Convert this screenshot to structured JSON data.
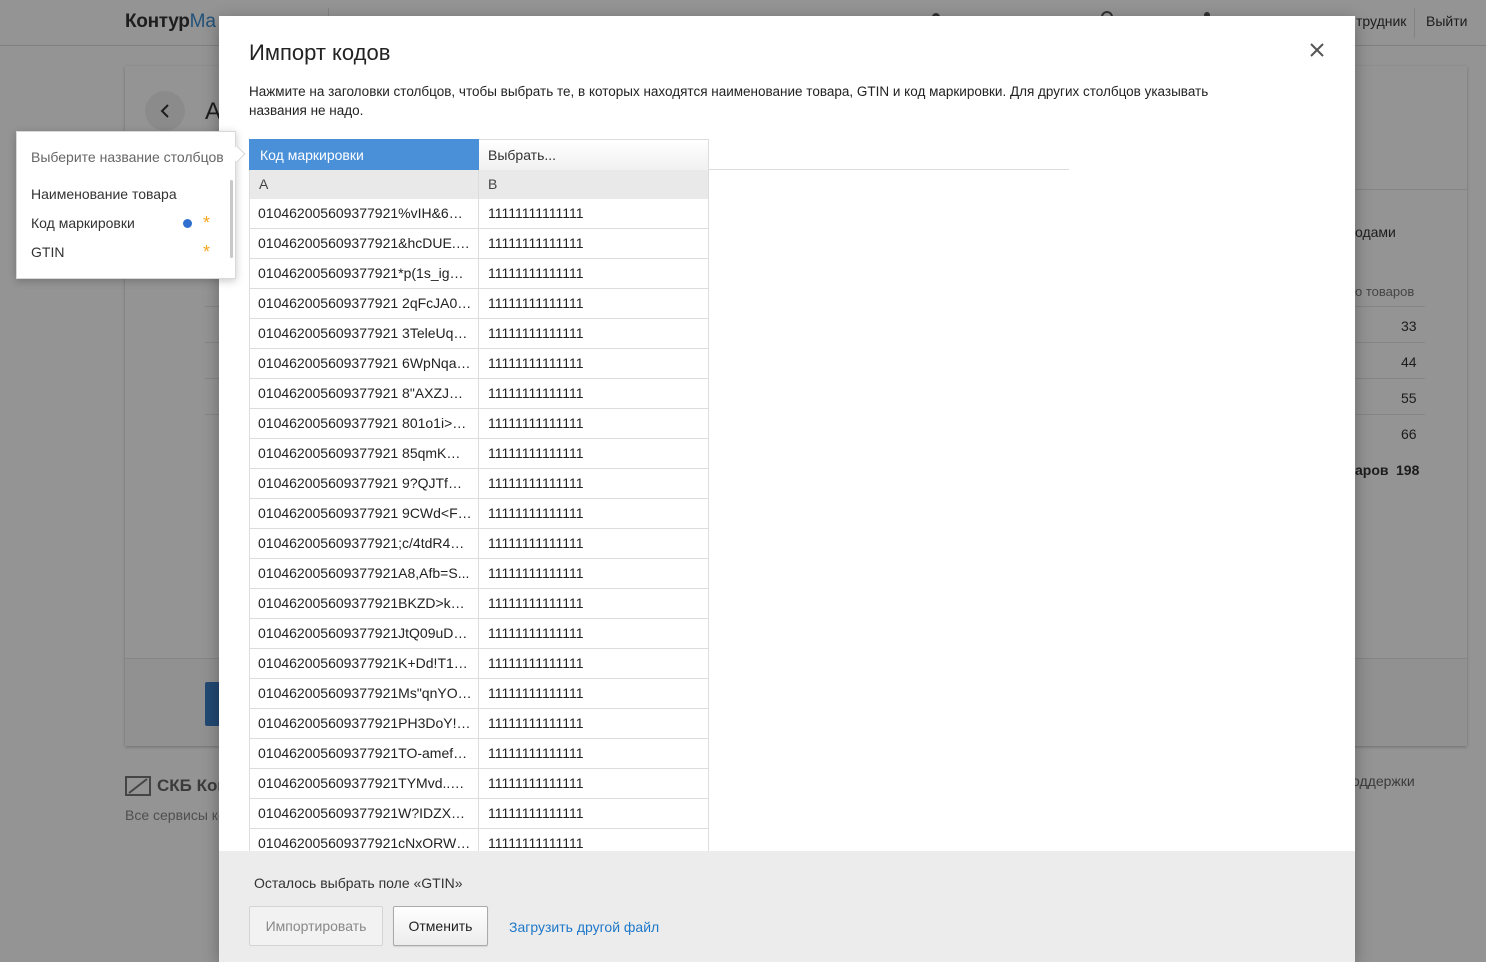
{
  "background": {
    "logo_main": "Контур",
    "logo_accent": "Ма",
    "header_user_fragment": "трудник",
    "logout_label": "Выйти",
    "card_title_fragment": "А",
    "side_heading_fragment": "одами",
    "column_header_fragment": "о товаров",
    "counts": [
      "33",
      "44",
      "55",
      "66"
    ],
    "total_label_fragment": "аров",
    "total_value": "198",
    "footer_company_fragment": "СКБ Кон",
    "footer_services_fragment": "Все сервисы ко",
    "support_fragment": "оддержки"
  },
  "modal": {
    "title": "Импорт кодов",
    "description": "Нажмите на заголовки столбцов, чтобы выбрать те, в которых находятся наименование товара, GTIN и код маркировки. Для других столбцов указывать названия не надо.",
    "columns": [
      {
        "header": "Код маркировки",
        "letter": "A",
        "selected": true
      },
      {
        "header": "Выбрать...",
        "letter": "B",
        "selected": false
      }
    ],
    "rows": [
      [
        "010462005609377921%vIH&6PZ...",
        "11111111111111"
      ],
      [
        "010462005609377921&hcDUE.w...",
        "11111111111111"
      ],
      [
        "010462005609377921*p(1s_igW...",
        "11111111111111"
      ],
      [
        "010462005609377921 2qFcJA0Ge...",
        "11111111111111"
      ],
      [
        "010462005609377921 3TeleUqst...",
        "11111111111111"
      ],
      [
        "010462005609377921 6WpNqa5)...",
        "11111111111111"
      ],
      [
        "010462005609377921 8\"AXZJXHt...",
        "11111111111111"
      ],
      [
        "010462005609377921 801o1i>db...",
        "11111111111111"
      ],
      [
        "010462005609377921 85qmKm_f...",
        "11111111111111"
      ],
      [
        "010462005609377921 9?QJTfQBo...",
        "11111111111111"
      ],
      [
        "010462005609377921 9CWd<Fv...",
        "11111111111111"
      ],
      [
        "010462005609377921;c/4tdR4Bv...",
        "11111111111111"
      ],
      [
        "010462005609377921A8,Afb=S...",
        "11111111111111"
      ],
      [
        "010462005609377921BKZD>ka7...",
        "11111111111111"
      ],
      [
        "010462005609377921JtQ09uDD...",
        "11111111111111"
      ],
      [
        "010462005609377921K+Dd!T1R...",
        "11111111111111"
      ],
      [
        "010462005609377921Ms\"qnYOc...",
        "11111111111111"
      ],
      [
        "010462005609377921PH3DoY!L...",
        "11111111111111"
      ],
      [
        "010462005609377921TO-amefYj...",
        "11111111111111"
      ],
      [
        "010462005609377921TYMvd..go...",
        "11111111111111"
      ],
      [
        "010462005609377921W?IDZXJfx...",
        "11111111111111"
      ],
      [
        "010462005609377921cNxORW7...",
        "11111111111111"
      ]
    ],
    "remaining_text": "Осталось выбрать поле «GTIN»",
    "import_button": "Импортировать",
    "cancel_button": "Отменить",
    "upload_link": "Загрузить другой файл"
  },
  "popup": {
    "caption": "Выберите название столбцов",
    "items": [
      {
        "label": "Наименование товара",
        "selected": false,
        "required": false
      },
      {
        "label": "Код маркировки",
        "selected": true,
        "required": true
      },
      {
        "label": "GTIN",
        "selected": false,
        "required": true
      }
    ]
  },
  "colors": {
    "accent_blue": "#4a90d9",
    "link_blue": "#1e78c9",
    "required_star": "#f5a623",
    "selected_dot": "#2f6fcf"
  }
}
